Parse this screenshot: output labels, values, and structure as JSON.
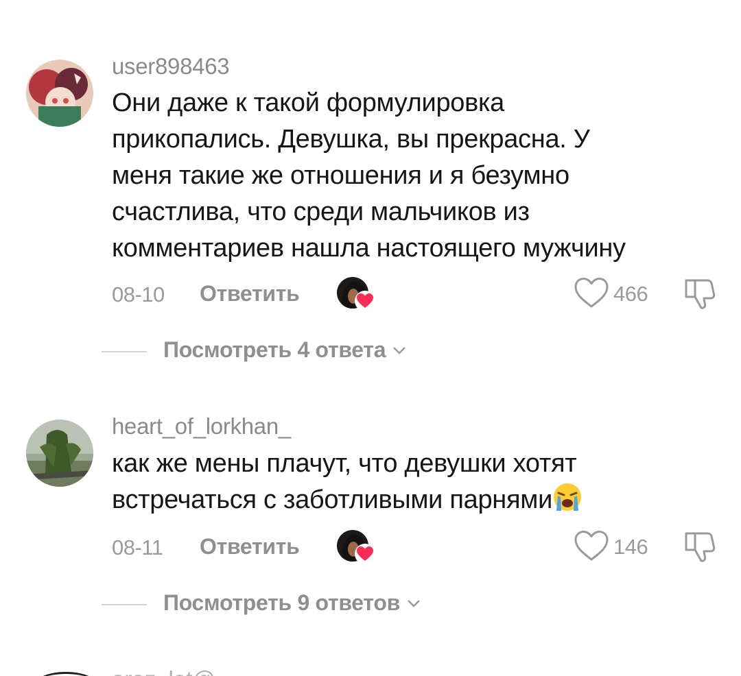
{
  "comments": [
    {
      "username": "user898463",
      "lines": [
        "Они даже к такой формулировка",
        "прикопались. Девушка, вы прекрасна. У",
        "меня такие же отношения и я безумно",
        "счастлива, что среди мальчиков из",
        "комментариев нашла настоящего мужчину"
      ],
      "date": "08-10",
      "reply_label": "Ответить",
      "likes": "466",
      "view_replies": "Посмотреть 4 ответа"
    },
    {
      "username": "heart_of_lorkhan_",
      "lines": [
        "как же мены плачут, что девушки хотят",
        "встречаться с заботливыми парнями"
      ],
      "emoji": "loudly-crying-face",
      "date": "08-11",
      "reply_label": "Ответить",
      "likes": "146",
      "view_replies": "Посмотреть 9 ответов"
    }
  ],
  "next_comment": {
    "username_partial": "araz_lat@"
  },
  "colors": {
    "text_primary": "#161616",
    "text_secondary": "#8f8f8f",
    "creator_heart": "#fe2c55"
  }
}
